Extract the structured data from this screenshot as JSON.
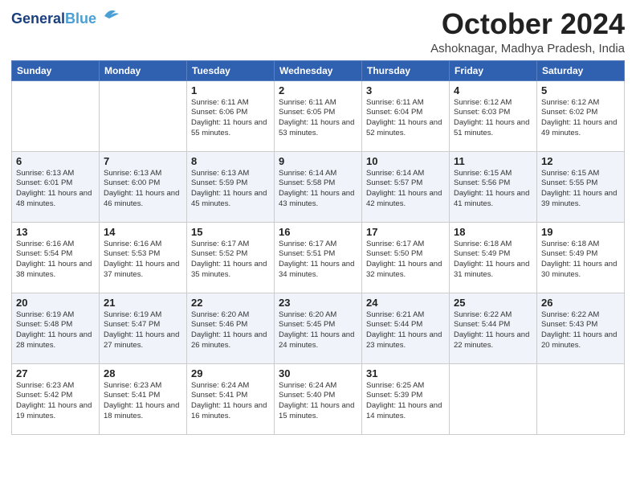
{
  "header": {
    "logo_line1": "General",
    "logo_line2": "Blue",
    "month": "October 2024",
    "location": "Ashoknagar, Madhya Pradesh, India"
  },
  "weekdays": [
    "Sunday",
    "Monday",
    "Tuesday",
    "Wednesday",
    "Thursday",
    "Friday",
    "Saturday"
  ],
  "weeks": [
    [
      {
        "day": "",
        "info": ""
      },
      {
        "day": "",
        "info": ""
      },
      {
        "day": "1",
        "info": "Sunrise: 6:11 AM\nSunset: 6:06 PM\nDaylight: 11 hours and 55 minutes."
      },
      {
        "day": "2",
        "info": "Sunrise: 6:11 AM\nSunset: 6:05 PM\nDaylight: 11 hours and 53 minutes."
      },
      {
        "day": "3",
        "info": "Sunrise: 6:11 AM\nSunset: 6:04 PM\nDaylight: 11 hours and 52 minutes."
      },
      {
        "day": "4",
        "info": "Sunrise: 6:12 AM\nSunset: 6:03 PM\nDaylight: 11 hours and 51 minutes."
      },
      {
        "day": "5",
        "info": "Sunrise: 6:12 AM\nSunset: 6:02 PM\nDaylight: 11 hours and 49 minutes."
      }
    ],
    [
      {
        "day": "6",
        "info": "Sunrise: 6:13 AM\nSunset: 6:01 PM\nDaylight: 11 hours and 48 minutes."
      },
      {
        "day": "7",
        "info": "Sunrise: 6:13 AM\nSunset: 6:00 PM\nDaylight: 11 hours and 46 minutes."
      },
      {
        "day": "8",
        "info": "Sunrise: 6:13 AM\nSunset: 5:59 PM\nDaylight: 11 hours and 45 minutes."
      },
      {
        "day": "9",
        "info": "Sunrise: 6:14 AM\nSunset: 5:58 PM\nDaylight: 11 hours and 43 minutes."
      },
      {
        "day": "10",
        "info": "Sunrise: 6:14 AM\nSunset: 5:57 PM\nDaylight: 11 hours and 42 minutes."
      },
      {
        "day": "11",
        "info": "Sunrise: 6:15 AM\nSunset: 5:56 PM\nDaylight: 11 hours and 41 minutes."
      },
      {
        "day": "12",
        "info": "Sunrise: 6:15 AM\nSunset: 5:55 PM\nDaylight: 11 hours and 39 minutes."
      }
    ],
    [
      {
        "day": "13",
        "info": "Sunrise: 6:16 AM\nSunset: 5:54 PM\nDaylight: 11 hours and 38 minutes."
      },
      {
        "day": "14",
        "info": "Sunrise: 6:16 AM\nSunset: 5:53 PM\nDaylight: 11 hours and 37 minutes."
      },
      {
        "day": "15",
        "info": "Sunrise: 6:17 AM\nSunset: 5:52 PM\nDaylight: 11 hours and 35 minutes."
      },
      {
        "day": "16",
        "info": "Sunrise: 6:17 AM\nSunset: 5:51 PM\nDaylight: 11 hours and 34 minutes."
      },
      {
        "day": "17",
        "info": "Sunrise: 6:17 AM\nSunset: 5:50 PM\nDaylight: 11 hours and 32 minutes."
      },
      {
        "day": "18",
        "info": "Sunrise: 6:18 AM\nSunset: 5:49 PM\nDaylight: 11 hours and 31 minutes."
      },
      {
        "day": "19",
        "info": "Sunrise: 6:18 AM\nSunset: 5:49 PM\nDaylight: 11 hours and 30 minutes."
      }
    ],
    [
      {
        "day": "20",
        "info": "Sunrise: 6:19 AM\nSunset: 5:48 PM\nDaylight: 11 hours and 28 minutes."
      },
      {
        "day": "21",
        "info": "Sunrise: 6:19 AM\nSunset: 5:47 PM\nDaylight: 11 hours and 27 minutes."
      },
      {
        "day": "22",
        "info": "Sunrise: 6:20 AM\nSunset: 5:46 PM\nDaylight: 11 hours and 26 minutes."
      },
      {
        "day": "23",
        "info": "Sunrise: 6:20 AM\nSunset: 5:45 PM\nDaylight: 11 hours and 24 minutes."
      },
      {
        "day": "24",
        "info": "Sunrise: 6:21 AM\nSunset: 5:44 PM\nDaylight: 11 hours and 23 minutes."
      },
      {
        "day": "25",
        "info": "Sunrise: 6:22 AM\nSunset: 5:44 PM\nDaylight: 11 hours and 22 minutes."
      },
      {
        "day": "26",
        "info": "Sunrise: 6:22 AM\nSunset: 5:43 PM\nDaylight: 11 hours and 20 minutes."
      }
    ],
    [
      {
        "day": "27",
        "info": "Sunrise: 6:23 AM\nSunset: 5:42 PM\nDaylight: 11 hours and 19 minutes."
      },
      {
        "day": "28",
        "info": "Sunrise: 6:23 AM\nSunset: 5:41 PM\nDaylight: 11 hours and 18 minutes."
      },
      {
        "day": "29",
        "info": "Sunrise: 6:24 AM\nSunset: 5:41 PM\nDaylight: 11 hours and 16 minutes."
      },
      {
        "day": "30",
        "info": "Sunrise: 6:24 AM\nSunset: 5:40 PM\nDaylight: 11 hours and 15 minutes."
      },
      {
        "day": "31",
        "info": "Sunrise: 6:25 AM\nSunset: 5:39 PM\nDaylight: 11 hours and 14 minutes."
      },
      {
        "day": "",
        "info": ""
      },
      {
        "day": "",
        "info": ""
      }
    ]
  ]
}
